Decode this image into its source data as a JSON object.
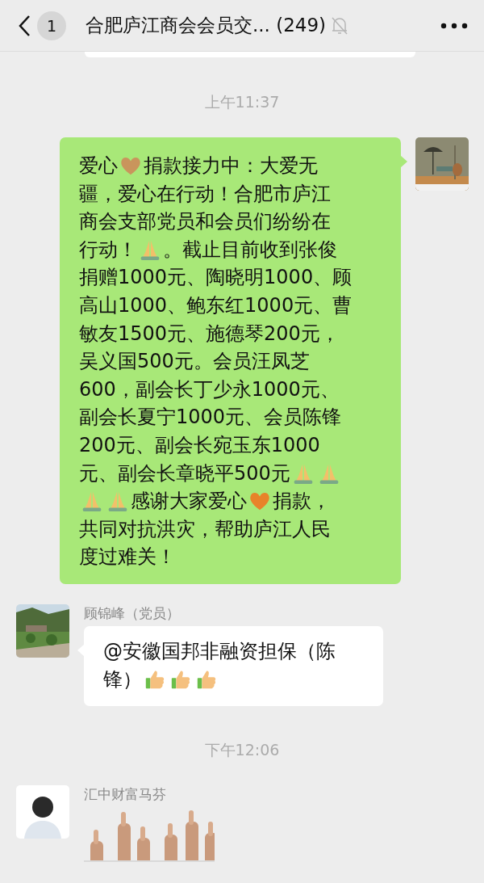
{
  "header": {
    "back_badge": "1",
    "title": "合肥庐江商会会员交... (249)",
    "muted": true
  },
  "messages": [
    {
      "kind": "time",
      "text": "上午11:37"
    },
    {
      "kind": "outgoing",
      "lines": [
        [
          {
            "kind": "text",
            "text": "爱心"
          },
          {
            "kind": "heart",
            "color": "#c9955c"
          },
          {
            "kind": "text",
            "text": "捐款接力中：大爱无"
          }
        ],
        [
          {
            "kind": "text",
            "text": "疆，爱心在行动！合肥市庐江"
          }
        ],
        [
          {
            "kind": "text",
            "text": "商会支部党员和会员们纷纷在"
          }
        ],
        [
          {
            "kind": "text",
            "text": "行动！ "
          },
          {
            "kind": "pray"
          },
          {
            "kind": "text",
            "text": "。截止目前收到张俊"
          }
        ],
        [
          {
            "kind": "text",
            "text": "捐赠1000元、陶晓明1000、顾"
          }
        ],
        [
          {
            "kind": "text",
            "text": "高山1000、鲍东红1000元、曹"
          }
        ],
        [
          {
            "kind": "text",
            "text": "敏友1500元、施德琴200元，"
          }
        ],
        [
          {
            "kind": "text",
            "text": "吴义国500元。会员汪凤芝"
          }
        ],
        [
          {
            "kind": "text",
            "text": "600，副会长丁少永1000元、"
          }
        ],
        [
          {
            "kind": "text",
            "text": "副会长夏宁1000元、会员陈锋"
          }
        ],
        [
          {
            "kind": "text",
            "text": "200元、副会长宛玉东1000"
          }
        ],
        [
          {
            "kind": "text",
            "text": "元、副会长章晓平500元"
          },
          {
            "kind": "pray"
          },
          {
            "kind": "pray"
          }
        ],
        [
          {
            "kind": "pray"
          },
          {
            "kind": "pray"
          },
          {
            "kind": "text",
            "text": "感谢大家爱心"
          },
          {
            "kind": "heart",
            "color": "#e8832a"
          },
          {
            "kind": "text",
            "text": "捐款，"
          }
        ],
        [
          {
            "kind": "text",
            "text": "共同对抗洪灾，帮助庐江人民"
          }
        ],
        [
          {
            "kind": "text",
            "text": "度过难关！"
          }
        ]
      ]
    },
    {
      "kind": "incoming",
      "sender": "顾锦峰（党员）",
      "lines": [
        [
          {
            "kind": "text",
            "text": "@安徽国邦非融资担保（陈"
          }
        ],
        [
          {
            "kind": "text",
            "text": "锋）"
          },
          {
            "kind": "thumb"
          },
          {
            "kind": "thumb"
          },
          {
            "kind": "thumb"
          }
        ]
      ]
    },
    {
      "kind": "time",
      "text": "下午12:06"
    },
    {
      "kind": "incoming_image",
      "sender": "汇中财富马芬"
    }
  ]
}
